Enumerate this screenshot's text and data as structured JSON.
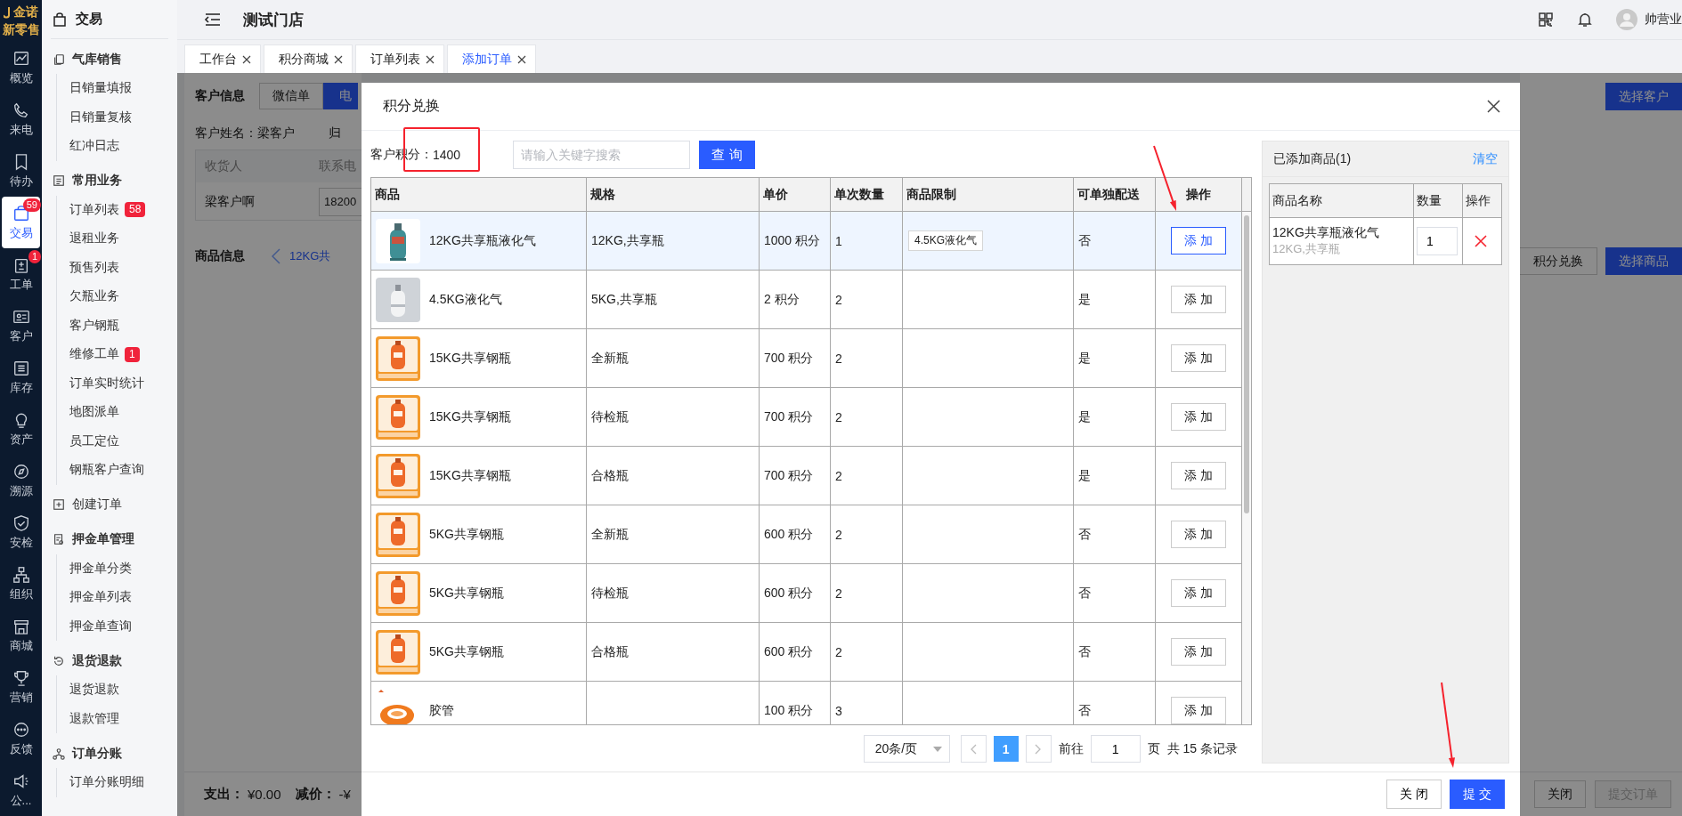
{
  "rail": {
    "logo": {
      "brand": "金诺",
      "tagline": "新零售"
    },
    "items": [
      {
        "label": "概览",
        "selected": false
      },
      {
        "label": "来电",
        "selected": false
      },
      {
        "label": "待办",
        "selected": false
      },
      {
        "label": "交易",
        "selected": true,
        "badge": "59"
      },
      {
        "label": "工单",
        "selected": false,
        "badge": "1"
      },
      {
        "label": "客户",
        "selected": false
      },
      {
        "label": "库存",
        "selected": false
      },
      {
        "label": "资产",
        "selected": false
      },
      {
        "label": "溯源",
        "selected": false
      },
      {
        "label": "安检",
        "selected": false
      },
      {
        "label": "组织",
        "selected": false
      },
      {
        "label": "商城",
        "selected": false
      },
      {
        "label": "营销",
        "selected": false
      },
      {
        "label": "反馈",
        "selected": false
      },
      {
        "label": "公...",
        "selected": false
      }
    ]
  },
  "sidebar": {
    "title": "交易",
    "groups": [
      {
        "label": "气库销售",
        "kind": "section",
        "children": [
          {
            "label": "日销量填报"
          },
          {
            "label": "日销量复核"
          },
          {
            "label": "红冲日志"
          }
        ]
      },
      {
        "label": "常用业务",
        "kind": "section",
        "children": [
          {
            "label": "订单列表",
            "badge": "58"
          },
          {
            "label": "退租业务"
          },
          {
            "label": "预售列表"
          },
          {
            "label": "欠瓶业务"
          },
          {
            "label": "客户钢瓶"
          },
          {
            "label": "维修工单",
            "badge": "1"
          },
          {
            "label": "订单实时统计"
          },
          {
            "label": "地图派单"
          },
          {
            "label": "员工定位"
          },
          {
            "label": "钢瓶客户查询"
          }
        ]
      },
      {
        "label": "创建订单",
        "kind": "entry"
      },
      {
        "label": "押金单管理",
        "kind": "section",
        "children": [
          {
            "label": "押金单分类"
          },
          {
            "label": "押金单列表"
          },
          {
            "label": "押金单查询"
          }
        ]
      },
      {
        "label": "退货退款",
        "kind": "section",
        "children": [
          {
            "label": "退货退款"
          },
          {
            "label": "退款管理"
          }
        ]
      },
      {
        "label": "订单分账",
        "kind": "section",
        "children": [
          {
            "label": "订单分账明细"
          }
        ]
      }
    ]
  },
  "header": {
    "store": "测试门店",
    "user": "帅营业"
  },
  "tabs": [
    {
      "label": "工作台",
      "selected": false
    },
    {
      "label": "积分商城",
      "selected": false
    },
    {
      "label": "订单列表",
      "selected": false
    },
    {
      "label": "添加订单",
      "selected": true
    }
  ],
  "page": {
    "customer_label": "客户信息",
    "order_types": [
      {
        "label": "微信单",
        "selected": false
      },
      {
        "label": "电",
        "selected": true
      }
    ],
    "customer_name": "客户姓名：梁客户",
    "affiliation": "归",
    "receiver_columns": [
      "收货人",
      "联系电"
    ],
    "receiver": {
      "name": "梁客户啊",
      "phone": "18200"
    },
    "goods_label": "商品信息",
    "goods_tab": "12KG共",
    "select_customer": "选择客户",
    "points_exchange": "积分兑换",
    "select_goods": "选择商品",
    "footer": {
      "spend_label": "支出：",
      "spend": "¥0.00",
      "discount_label": "减价：",
      "discount": "-¥",
      "close": "关闭",
      "submit": "提交订单"
    }
  },
  "dialog": {
    "title": "积分兑换",
    "points_label": "客户积分：",
    "points": "1400",
    "search": {
      "placeholder": "请输入关键字搜索"
    },
    "search_button": "查 询",
    "columns": [
      "商品",
      "规格",
      "单价",
      "单次数量",
      "商品限制",
      "可单独配送",
      "操作"
    ],
    "rows": [
      {
        "name": "12KG共享瓶液化气",
        "spec": "12KG,共享瓶",
        "price": "1000 积分",
        "qty": "1",
        "limit": "4.5KG液化气",
        "delivery": "否",
        "action": "添 加",
        "selected": true
      },
      {
        "name": "4.5KG液化气",
        "spec": "5KG,共享瓶",
        "price": "2 积分",
        "qty": "2",
        "delivery": "是",
        "action": "添 加",
        "selected": false
      },
      {
        "name": "15KG共享钢瓶",
        "spec": "全新瓶",
        "price": "700 积分",
        "qty": "2",
        "delivery": "是",
        "action": "添 加",
        "selected": false
      },
      {
        "name": "15KG共享钢瓶",
        "spec": "待检瓶",
        "price": "700 积分",
        "qty": "2",
        "delivery": "是",
        "action": "添 加",
        "selected": false
      },
      {
        "name": "15KG共享钢瓶",
        "spec": "合格瓶",
        "price": "700 积分",
        "qty": "2",
        "delivery": "是",
        "action": "添 加",
        "selected": false
      },
      {
        "name": "5KG共享钢瓶",
        "spec": "全新瓶",
        "price": "600 积分",
        "qty": "2",
        "delivery": "否",
        "action": "添 加",
        "selected": false
      },
      {
        "name": "5KG共享钢瓶",
        "spec": "待检瓶",
        "price": "600 积分",
        "qty": "2",
        "delivery": "否",
        "action": "添 加",
        "selected": false
      },
      {
        "name": "5KG共享钢瓶",
        "spec": "合格瓶",
        "price": "600 积分",
        "qty": "2",
        "delivery": "否",
        "action": "添 加",
        "selected": false
      },
      {
        "name": "胶管",
        "price": "100 积分",
        "qty": "3",
        "delivery": "否",
        "action": "添 加",
        "selected": false
      }
    ],
    "pagination": {
      "page_size": "20条/页",
      "pages": [
        {
          "label": "1",
          "selected": true
        }
      ],
      "goto_label": "前往",
      "goto": "1",
      "page_unit": "页",
      "total": "共 15 条记录"
    },
    "cart": {
      "title": "已添加商品(1)",
      "clear": "清空",
      "columns": [
        "商品名称",
        "数量",
        "操作"
      ],
      "items": [
        {
          "name": "12KG共享瓶液化气",
          "spec": "12KG,共享瓶",
          "qty": "1"
        }
      ]
    },
    "close": "关 闭",
    "submit": "提 交"
  },
  "annotations": [
    {
      "kind": "box"
    },
    {
      "kind": "arrow"
    },
    {
      "kind": "arrow"
    }
  ]
}
